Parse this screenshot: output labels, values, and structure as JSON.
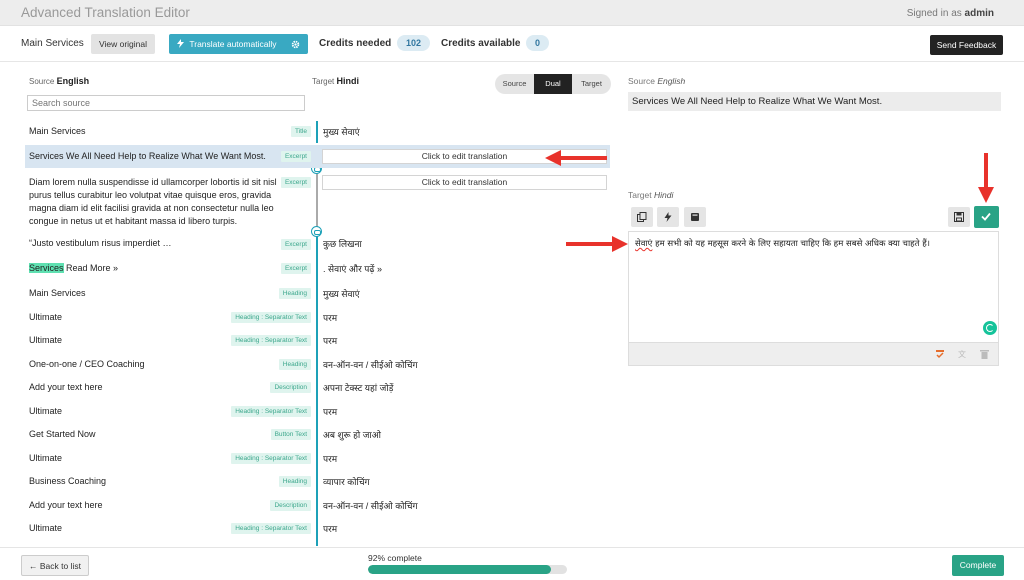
{
  "header": {
    "title": "Advanced Translation Editor",
    "signed_in_prefix": "Signed in as",
    "user": "admin"
  },
  "toolbar": {
    "page_name": "Main Services",
    "view_original": "View original",
    "translate_auto": "Translate automatically",
    "credits_needed_label": "Credits needed",
    "credits_needed": "102",
    "credits_available_label": "Credits available",
    "credits_available": "0",
    "send_feedback": "Send Feedback"
  },
  "columns": {
    "source_label": "Source",
    "source_lang": "English",
    "target_label": "Target",
    "target_lang": "Hindi",
    "search_placeholder": "Search source"
  },
  "view_toggle": {
    "source": "Source",
    "dual": "Dual",
    "target": "Target",
    "active": "Dual"
  },
  "rows": [
    {
      "source": "Main Services",
      "tag": "Title",
      "target": "मुख्य सेवाएं"
    },
    {
      "source": "Services We All Need Help to Realize What We Want Most.",
      "tag": "Excerpt",
      "target": "Click to edit translation"
    },
    {
      "source": "Diam lorem nulla suspendisse id ullamcorper lobortis id sit nisl purus tellus curabitur leo volutpat vitae quisque eros, gravida magna diam id elit facilisi gravida at non consectetur nulla leo congue in netus ut et habitant massa id libero turpis.",
      "tag": "Excerpt",
      "target": "Click to edit translation"
    },
    {
      "source": "“Justo vestibulum risus imperdiet …",
      "tag": "Excerpt",
      "target": "कुछ लिखना"
    },
    {
      "source_highlight": "Services",
      "source_rest": " Read More »",
      "tag": "Excerpt",
      "target": ". सेवाएं और पढ़ें »"
    },
    {
      "source": "Main Services",
      "tag": "Heading",
      "target": "मुख्य सेवाएं"
    },
    {
      "source": "Ultimate",
      "tag": "Heading : Separator Text",
      "target": "परम"
    },
    {
      "source": "Ultimate",
      "tag": "Heading : Separator Text",
      "target": "परम"
    },
    {
      "source": "One-on-one / CEO Coaching",
      "tag": "Heading",
      "target": "वन-ऑन-वन / सीईओ कोचिंग"
    },
    {
      "source": "Add your text here",
      "tag": "Description",
      "target": "अपना टेक्स्ट यहां जोड़ें"
    },
    {
      "source": "Ultimate",
      "tag": "Heading : Separator Text",
      "target": "परम"
    },
    {
      "source": "Get Started Now",
      "tag": "Button Text",
      "target": "अब शुरू हो जाओ"
    },
    {
      "source": "Ultimate",
      "tag": "Heading : Separator Text",
      "target": "परम"
    },
    {
      "source": "Business Coaching",
      "tag": "Heading",
      "target": "व्यापार कोचिंग"
    },
    {
      "source": "Add your text here",
      "tag": "Description",
      "target": "वन-ऑन-वन / सीईओ कोचिंग"
    },
    {
      "source": "Ultimate",
      "tag": "Heading : Separator Text",
      "target": "परम"
    }
  ],
  "right_panel": {
    "source_label": "Source",
    "source_lang": "English",
    "source_text": "Services We All Need Help to Realize What We Want Most.",
    "target_label": "Target",
    "target_lang": "Hindi",
    "target_first_word": "सेवाएं",
    "target_rest": " हम सभी को यह महसूस करने के लिए सहायता चाहिए कि हम सबसे अधिक क्या चाहते हैं।"
  },
  "footer": {
    "back": "← Back to list",
    "progress_text": "92% complete",
    "progress": 0.92,
    "complete": "Complete"
  },
  "colors": {
    "accent": "#29a386",
    "teal": "#39a9c2",
    "arrow": "#e8322b",
    "selected_row": "#d8e5f1"
  }
}
